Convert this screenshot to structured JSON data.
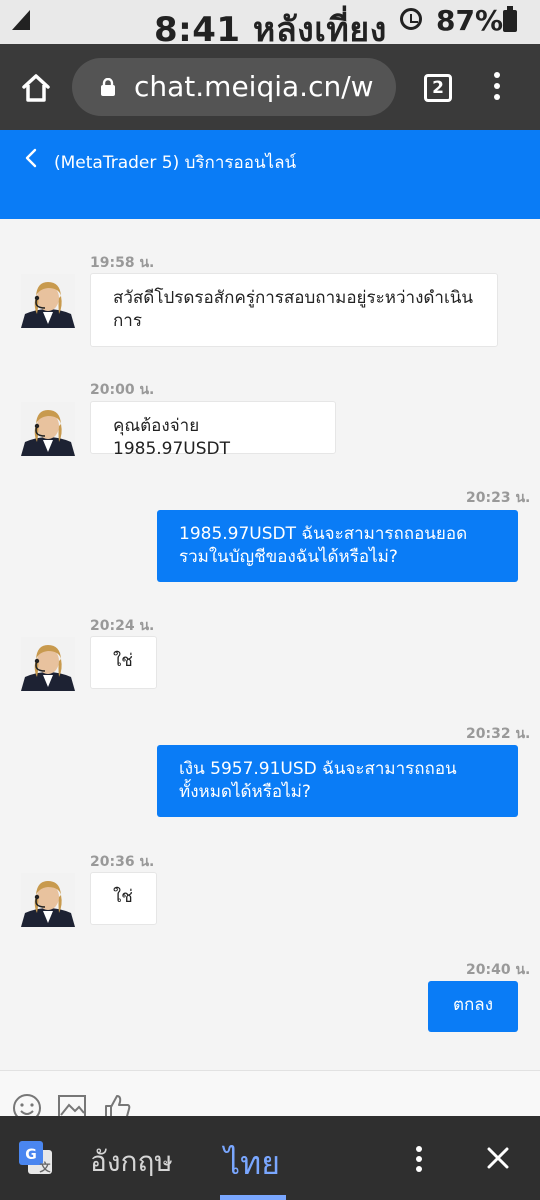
{
  "status_bar": {
    "time": "8:41 หลังเที่ยง",
    "battery": "87%"
  },
  "browser": {
    "url": "chat.meiqia.cn/w",
    "tab_count": "2"
  },
  "chat": {
    "title": "(MetaTrader 5) บริการออนไลน์",
    "messages": [
      {
        "side": "left",
        "time": "19:58 น.",
        "text": "สวัสดีโปรดรอสักครู่การสอบถามอยู่ระหว่างดำเนินการ"
      },
      {
        "side": "left",
        "time": "20:00 น.",
        "text": "คุณต้องจ่าย 1985.97USDT"
      },
      {
        "side": "right",
        "time": "20:23 น.",
        "text": "1985.97USDT ฉันจะสามารถถอนยอดรวมในบัญชีของฉันได้หรือไม่?"
      },
      {
        "side": "left",
        "time": "20:24 น.",
        "text": "ใช่"
      },
      {
        "side": "right",
        "time": "20:32 น.",
        "text": "เงิน 5957.91USD ฉันจะสามารถถอนทั้งหมดได้หรือไม่?"
      },
      {
        "side": "left",
        "time": "20:36 น.",
        "text": "ใช่"
      },
      {
        "side": "right",
        "time": "20:40 น.",
        "text": "ตกลง"
      }
    ]
  },
  "translate_bar": {
    "source_lang": "อังกฤษ",
    "target_lang": "ไทย"
  },
  "colors": {
    "accent": "#0a7cf6",
    "browser_bar": "#3a3a3a",
    "translate_bar": "#2f2f2f"
  }
}
